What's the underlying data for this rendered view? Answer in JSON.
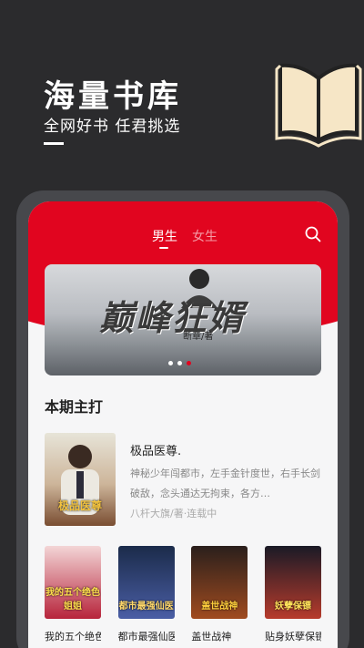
{
  "promo": {
    "title": "海量书库",
    "subtitle": "全网好书  任君挑选"
  },
  "header": {
    "tabs": [
      {
        "label": "男生",
        "active": true
      },
      {
        "label": "女生",
        "active": false
      }
    ],
    "accent_color": "#e1051f"
  },
  "banner": {
    "title": "巅峰狂婿",
    "author": "断章/著",
    "dots": [
      false,
      false,
      true
    ]
  },
  "section": {
    "title": "本期主打"
  },
  "featured": {
    "title": "极品医尊.",
    "description": "神秘少年闯都市，左手金针度世，右手长剑破敌，念头通达无拘束，各方…",
    "author": "八杆大旗/著·连载中",
    "cover_text": "极品医尊"
  },
  "books": [
    {
      "label": "我的五个绝色姐姐",
      "cover_text": "我的五个绝色姐姐",
      "color_top": "#f3d5d6",
      "color_bottom": "#b7243b"
    },
    {
      "label": "都市最强仙医",
      "cover_text": "都市最强仙医",
      "color_top": "#1b2b4a",
      "color_bottom": "#4a5ea5"
    },
    {
      "label": "盖世战神",
      "cover_text": "盖世战神",
      "color_top": "#2a1f1c",
      "color_bottom": "#a04b1f"
    },
    {
      "label": "贴身妖孽保镖",
      "cover_text": "妖孽保镖",
      "color_top": "#1a1a26",
      "color_bottom": "#b73b2c"
    }
  ]
}
